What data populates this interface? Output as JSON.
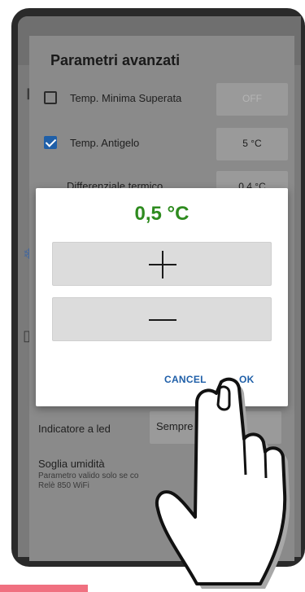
{
  "settings": {
    "title": "Parametri avanzati",
    "rows": [
      {
        "label": "Temp. Minima Superata",
        "checked": false,
        "value": "OFF"
      },
      {
        "label": "Temp. Antigelo",
        "checked": true,
        "value": "5 °C"
      },
      {
        "label": "Differenziale termico",
        "value": "0,4 °C"
      }
    ],
    "led": {
      "label": "Indicatore a led",
      "value": "Sempre"
    },
    "humidity": {
      "label": "Soglia umidità",
      "note_line1": "Parametro valido solo se co",
      "note_line2": "Relè 850 WiFi"
    }
  },
  "dialog": {
    "value": "0,5 °C",
    "cancel_label": "CANCEL",
    "ok_label": "OK"
  },
  "colors": {
    "accent": "#1f5fa8",
    "value_green": "#2e8b1f",
    "highlight_bar": "#f07080"
  }
}
